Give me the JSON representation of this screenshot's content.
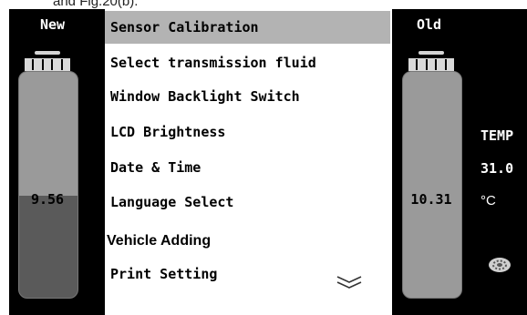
{
  "caption": "and Fig.20(b).",
  "left_tank": {
    "title": "New",
    "value": "9.56",
    "fill_fraction": 0.45
  },
  "right_tank": {
    "title": "Old",
    "value": "10.31"
  },
  "menu": {
    "items": [
      {
        "label": "Sensor Calibration",
        "selected": true
      },
      {
        "label": "Select transmission fluid"
      },
      {
        "label": "Window Backlight Switch"
      },
      {
        "label": "LCD Brightness"
      },
      {
        "label": "Date & Time"
      },
      {
        "label": "Language Select"
      },
      {
        "label": "Vehicle Adding"
      },
      {
        "label": "Print Setting"
      }
    ],
    "scroll_icon": "chevron-double-down-icon"
  },
  "temperature": {
    "label": "TEMP",
    "value": "31.0",
    "unit": "°C"
  },
  "icons": {
    "gear": "gear-icon"
  }
}
